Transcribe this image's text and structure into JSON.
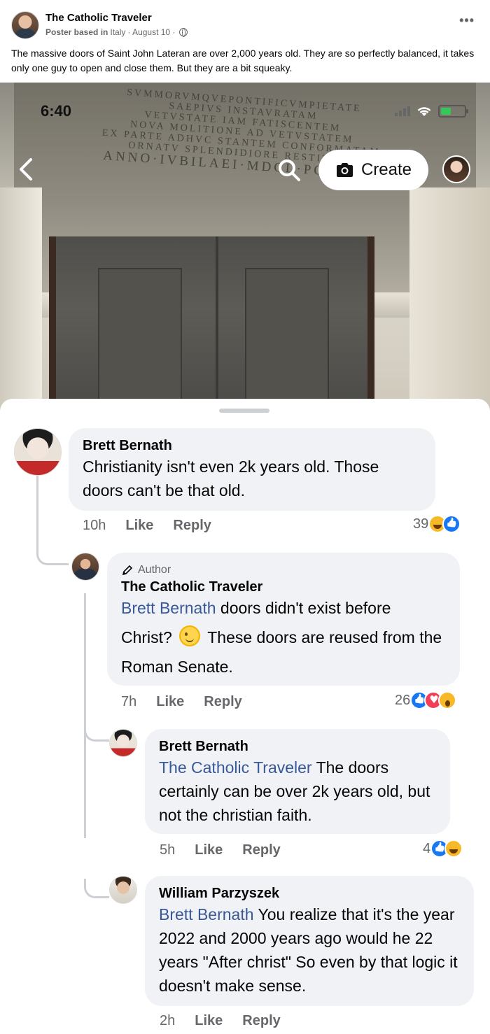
{
  "post": {
    "author": "The Catholic Traveler",
    "meta_prefix": "Poster based in",
    "meta_location": "Italy",
    "meta_time": "· August 10 ·",
    "text": "The massive doors of Saint John Lateran are over 2,000 years old. They are so perfectly balanced, it takes only one guy to open and close them. But they are a bit squeaky.",
    "more_label": "•••"
  },
  "photo": {
    "inscription_lines": [
      "SVMMORVMQVEPONTIFICVMPIETATE",
      "SAEPIVS INSTAVRATAM",
      "VETVSTATE IAM FATISCENTEM",
      "NOVA MOLITIONE AD VETVSTATEM",
      "EX PARTE ADHVC STANTEM CONFORMATAM",
      "ORNATV SPLENDIDIORE RESTITVIT"
    ],
    "inscription_big": "ANNO·IVBILAEI·MDCL·PONT·VI"
  },
  "status_bar": {
    "time": "6:40"
  },
  "story_toolbar": {
    "create_label": "Create"
  },
  "comments": [
    {
      "name": "Brett Bernath",
      "text": "Christianity isn't even 2k years old. Those doors can't be that old.",
      "time": "10h",
      "like": "Like",
      "reply": "Reply",
      "reaction_count": "39",
      "reactions": [
        "haha",
        "like"
      ]
    },
    {
      "badge": "Author",
      "name": "The Catholic Traveler",
      "mention": "Brett Bernath",
      "text_a": " doors didn't exist before",
      "text_b": "Christ?",
      "text_c": " These doors are reused from the Roman Senate.",
      "time": "7h",
      "like": "Like",
      "reply": "Reply",
      "reaction_count": "26",
      "reactions": [
        "like",
        "love",
        "wow"
      ]
    },
    {
      "name": "Brett Bernath",
      "mention": "The Catholic Traveler",
      "text": " The doors certainly can be over 2k years old, but not the christian faith.",
      "time": "5h",
      "like": "Like",
      "reply": "Reply",
      "reaction_count": "4",
      "reactions": [
        "like",
        "haha"
      ]
    },
    {
      "name": "William Parzyszek",
      "mention": "Brett Bernath",
      "text": " You realize that it's the year 2022 and 2000 years ago would he 22 years \"After christ\" So even by that logic it doesn't make sense.",
      "time": "2h",
      "like": "Like",
      "reply": "Reply"
    }
  ]
}
